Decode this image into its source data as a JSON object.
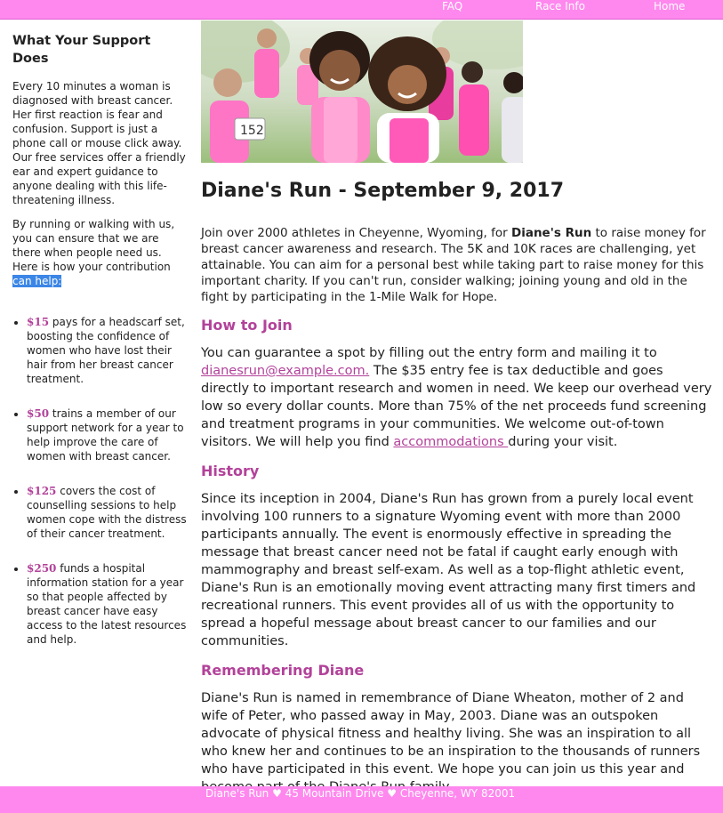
{
  "nav": {
    "faq": "FAQ",
    "race_info": "Race Info",
    "home": "Home"
  },
  "sidebar": {
    "heading": "What Your Support Does",
    "para1": "Every 10 minutes a woman is diagnosed with breast cancer. Her first reaction is fear and confusion. Support is just a phone call or mouse click away. Our free services offer a friendly ear and expert guidance to anyone dealing with this life-threatening illness.",
    "para2_lead": "By running or walking with us, you can ensure that we are there when people need us. Here is how your contribution ",
    "para2_selected": "can help:",
    "items": [
      {
        "amount": "$15",
        "text": " pays for a headscarf set, boosting the confidence of women who have lost their hair from her breast cancer treatment."
      },
      {
        "amount": "$50",
        "text": " trains a member of our support network for a year to help improve the care of women with breast cancer."
      },
      {
        "amount": "$125",
        "text": " covers the cost of counselling sessions to help women cope with the distress of their cancer treatment."
      },
      {
        "amount": "$250",
        "text": " funds a hospital information station for a year so that people affected by breast cancer have easy access to the latest resources and help."
      }
    ]
  },
  "main": {
    "title": "Diane's Run - September 9, 2017",
    "intro_a": "Join over 2000 athletes in Cheyenne, Wyoming, for ",
    "intro_bold": "Diane's Run",
    "intro_b": " to raise money for breast cancer awareness and research. The 5K and 10K races are challenging, yet attainable. You can aim for a personal best while taking part to raise money for this important charity. If you can't run, consider walking; joining young and old in the fight by participating in the 1-Mile Walk for Hope.",
    "join_heading": "How to Join",
    "join_a": "You can guarantee a spot by filling out the entry form and mailing it to ",
    "join_email": "dianesrun@example.com.",
    "join_b": " The $35 entry fee is tax deductible and goes directly to important research and women in need. We keep our overhead very low so every dollar counts. More than 75% of the net proceeds fund screening and treatment programs in your communities. We welcome out-of-town visitors. We will help you find ",
    "join_link": "accommodations ",
    "join_c": "during your visit.",
    "history_heading": "History",
    "history_text": "Since its inception in 2004, Diane's Run has grown from a purely local event involving 100 runners to a signature Wyoming event with more than 2000 participants annually. The event is enormously effective in spreading the message that breast cancer need not be fatal if caught early enough with mammography and breast self-exam. As well as a top-flight athletic event, Diane's Run is an emotionally moving event attracting many first timers and recreational runners. This event provides all of us with the opportunity to spread a hopeful message about breast cancer to our families and our communities.",
    "remember_heading": "Remembering Diane",
    "remember_text": "Diane's Run is named in remembrance of Diane Wheaton, mother of 2 and wife of Peter, who passed away in May, 2003. Diane was an outspoken advocate of physical fitness and healthy living. She was an inspiration to all who knew her and continues to be an inspiration to the thousands of runners who have participated in this event. We hope you can join us this year and become part of the Diane's Run family."
  },
  "hero": {
    "bib_number": "152"
  },
  "footer": {
    "text": "Diane's Run ♥ 45 Mountain Drive ♥ Cheyenne, WY 82001"
  },
  "colors": {
    "nav_background": "#ff88ee",
    "accent": "#b3429a",
    "selection": "#3b86e6"
  }
}
